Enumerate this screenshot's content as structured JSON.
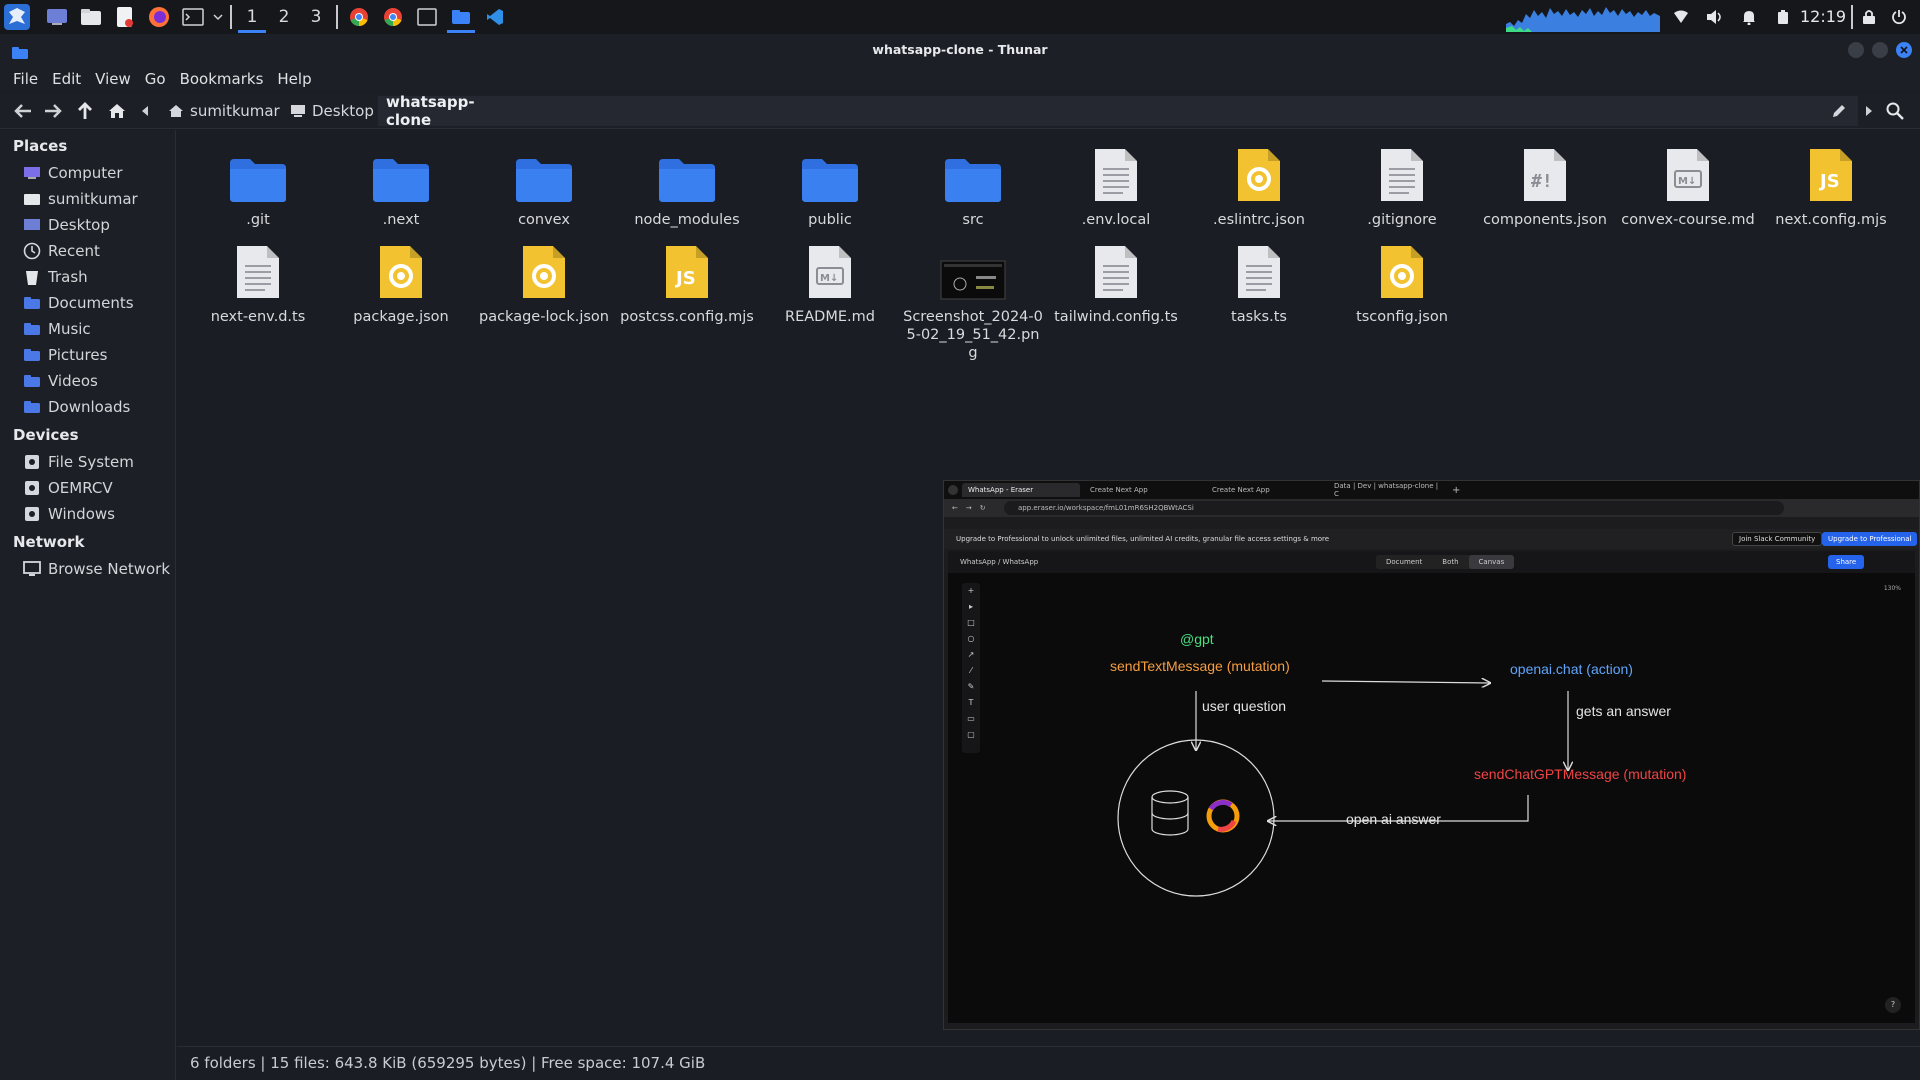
{
  "panel": {
    "workspaces": [
      "1",
      "2",
      "3"
    ],
    "active_workspace": "1",
    "clock": "12:19",
    "icons": [
      "launcher-icon",
      "desktop-icon",
      "file-manager-icon",
      "text-editor-icon",
      "firefox-icon",
      "terminal-icon",
      "chevron-down-icon"
    ],
    "tasks": [
      "chrome-icon",
      "chrome-icon",
      "terminal-icon",
      "thunar-icon",
      "vscode-icon"
    ],
    "tray": [
      "cpu-graph",
      "network-icon",
      "volume-icon",
      "notification-icon",
      "battery-icon",
      "lock-icon",
      "power-icon"
    ]
  },
  "window": {
    "title": "whatsapp-clone - Thunar"
  },
  "menubar": [
    "File",
    "Edit",
    "View",
    "Go",
    "Bookmarks",
    "Help"
  ],
  "breadcrumb": [
    {
      "label": "sumitkumar",
      "icon": "home-icon"
    },
    {
      "label": "Desktop",
      "icon": "desktop-icon"
    },
    {
      "label": "whatsapp-clone",
      "icon": ""
    }
  ],
  "sidebar": {
    "places_title": "Places",
    "places": [
      {
        "label": "Computer",
        "icon": "computer-icon"
      },
      {
        "label": "sumitkumar",
        "icon": "home-folder-icon"
      },
      {
        "label": "Desktop",
        "icon": "desktop-icon"
      },
      {
        "label": "Recent",
        "icon": "recent-icon"
      },
      {
        "label": "Trash",
        "icon": "trash-icon"
      },
      {
        "label": "Documents",
        "icon": "documents-icon"
      },
      {
        "label": "Music",
        "icon": "music-icon"
      },
      {
        "label": "Pictures",
        "icon": "pictures-icon"
      },
      {
        "label": "Videos",
        "icon": "videos-icon"
      },
      {
        "label": "Downloads",
        "icon": "downloads-icon"
      }
    ],
    "devices_title": "Devices",
    "devices": [
      {
        "label": "File System",
        "icon": "drive-icon"
      },
      {
        "label": "OEMRCV",
        "icon": "drive-icon"
      },
      {
        "label": "Windows",
        "icon": "drive-icon"
      }
    ],
    "network_title": "Network",
    "network": [
      {
        "label": "Browse Network",
        "icon": "network-icon"
      }
    ]
  },
  "files": [
    {
      "name": ".git",
      "type": "folder"
    },
    {
      "name": ".next",
      "type": "folder"
    },
    {
      "name": "convex",
      "type": "folder"
    },
    {
      "name": "node_modules",
      "type": "folder"
    },
    {
      "name": "public",
      "type": "folder"
    },
    {
      "name": "src",
      "type": "folder"
    },
    {
      "name": ".env.local",
      "type": "text"
    },
    {
      "name": ".eslintrc.json",
      "type": "json"
    },
    {
      "name": ".gitignore",
      "type": "text"
    },
    {
      "name": "components.json",
      "type": "shebang"
    },
    {
      "name": "convex-course.md",
      "type": "markdown"
    },
    {
      "name": "next.config.mjs",
      "type": "js"
    },
    {
      "name": "next-env.d.ts",
      "type": "text"
    },
    {
      "name": "package.json",
      "type": "json"
    },
    {
      "name": "package-lock.json",
      "type": "json"
    },
    {
      "name": "postcss.config.mjs",
      "type": "js"
    },
    {
      "name": "README.md",
      "type": "markdown"
    },
    {
      "name": "Screenshot_2024-05-02_19_51_42.png",
      "type": "image"
    },
    {
      "name": "tailwind.config.ts",
      "type": "text"
    },
    {
      "name": "tasks.ts",
      "type": "text"
    },
    {
      "name": "tsconfig.json",
      "type": "json"
    }
  ],
  "statusbar": "6 folders  |  15 files: 643.8 KiB (659295 bytes)  |  Free space: 107.4 GiB",
  "browser": {
    "tabs": [
      "WhatsApp - Eraser",
      "Create Next App",
      "Create Next App",
      "Data | Dev | whatsapp-clone | C"
    ],
    "url": "app.eraser.io/workspace/fmL01mR6SH2QBWtACSi",
    "banner": "Upgrade to Professional to unlock unlimited files, unlimited AI credits, granular file access settings & more",
    "banner_btn1": "Join Slack Community",
    "banner_btn2": "Upgrade to Professional",
    "crumb": "WhatsApp / WhatsApp",
    "segments": [
      "Document",
      "Both",
      "Canvas"
    ],
    "share": "Share",
    "zoom": "130%",
    "help": "?"
  },
  "diagram": {
    "gpt": "@gpt",
    "send_text": "sendTextMessage (mutation)",
    "openai": "openai.chat (action)",
    "user_question": "user question",
    "gets_answer": "gets an answer",
    "send_chatgpt": "sendChatGPTMessage (mutation)",
    "openai_answer": "open ai answer",
    "colors": {
      "gpt": "#4ade80",
      "send_text": "#f59e42",
      "openai": "#60a5fa",
      "send_chatgpt": "#ef4444",
      "label": "#e5e5e5"
    }
  },
  "colors": {
    "accent": "#3b82f6",
    "folder": "#2f6fe0",
    "json": "#f2c230",
    "js": "#f2c230"
  }
}
